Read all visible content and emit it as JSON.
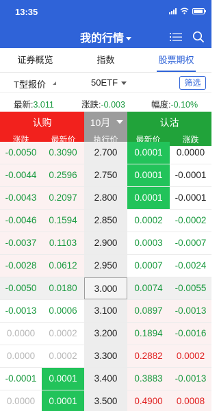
{
  "status_bar": {
    "time": "13:35"
  },
  "header": {
    "title": "我的行情"
  },
  "tabs": [
    {
      "label": "证券概览",
      "active": false
    },
    {
      "label": "指数",
      "active": false
    },
    {
      "label": "股票期权",
      "active": true
    }
  ],
  "filters": {
    "type_label": "T型报价",
    "underlying": "50ETF",
    "filter_button": "筛选"
  },
  "quote": {
    "latest_label": "最新:",
    "latest_value": "3.011",
    "change_label": "涨跌:",
    "change_value": "-0.003",
    "pct_label": "幅度:",
    "pct_value": "-0.10%"
  },
  "table_header": {
    "call_label": "认购",
    "put_label": "认沽",
    "month": "10月",
    "col_change": "涨跌",
    "col_latest": "最新价",
    "col_strike": "执行价"
  },
  "colors": {
    "brand": "#2f63d8",
    "call": "#f2211d",
    "put": "#21a33a",
    "highlight": "#22c35a"
  },
  "rows": [
    {
      "call_change": "-0.0050",
      "call_price": "0.3090",
      "strike": "2.700",
      "put_price": "0.0001",
      "put_change": "0.0000"
    },
    {
      "call_change": "-0.0044",
      "call_price": "0.2596",
      "strike": "2.750",
      "put_price": "0.0001",
      "put_change": "-0.0001"
    },
    {
      "call_change": "-0.0043",
      "call_price": "0.2097",
      "strike": "2.800",
      "put_price": "0.0001",
      "put_change": "-0.0001"
    },
    {
      "call_change": "-0.0046",
      "call_price": "0.1594",
      "strike": "2.850",
      "put_price": "0.0002",
      "put_change": "-0.0002"
    },
    {
      "call_change": "-0.0037",
      "call_price": "0.1103",
      "strike": "2.900",
      "put_price": "0.0003",
      "put_change": "-0.0007"
    },
    {
      "call_change": "-0.0028",
      "call_price": "0.0612",
      "strike": "2.950",
      "put_price": "0.0007",
      "put_change": "-0.0024"
    },
    {
      "call_change": "-0.0050",
      "call_price": "0.0180",
      "strike": "3.000",
      "put_price": "0.0074",
      "put_change": "-0.0055"
    },
    {
      "call_change": "-0.0013",
      "call_price": "0.0006",
      "strike": "3.100",
      "put_price": "0.0897",
      "put_change": "-0.0013"
    },
    {
      "call_change": "0.0000",
      "call_price": "0.0002",
      "strike": "3.200",
      "put_price": "0.1894",
      "put_change": "-0.0016"
    },
    {
      "call_change": "0.0000",
      "call_price": "0.0002",
      "strike": "3.300",
      "put_price": "0.2882",
      "put_change": "0.0002"
    },
    {
      "call_change": "-0.0001",
      "call_price": "0.0001",
      "strike": "3.400",
      "put_price": "0.3883",
      "put_change": "-0.0013"
    },
    {
      "call_change": "0.0000",
      "call_price": "0.0001",
      "strike": "3.500",
      "put_price": "0.4900",
      "put_change": "0.0008"
    }
  ]
}
